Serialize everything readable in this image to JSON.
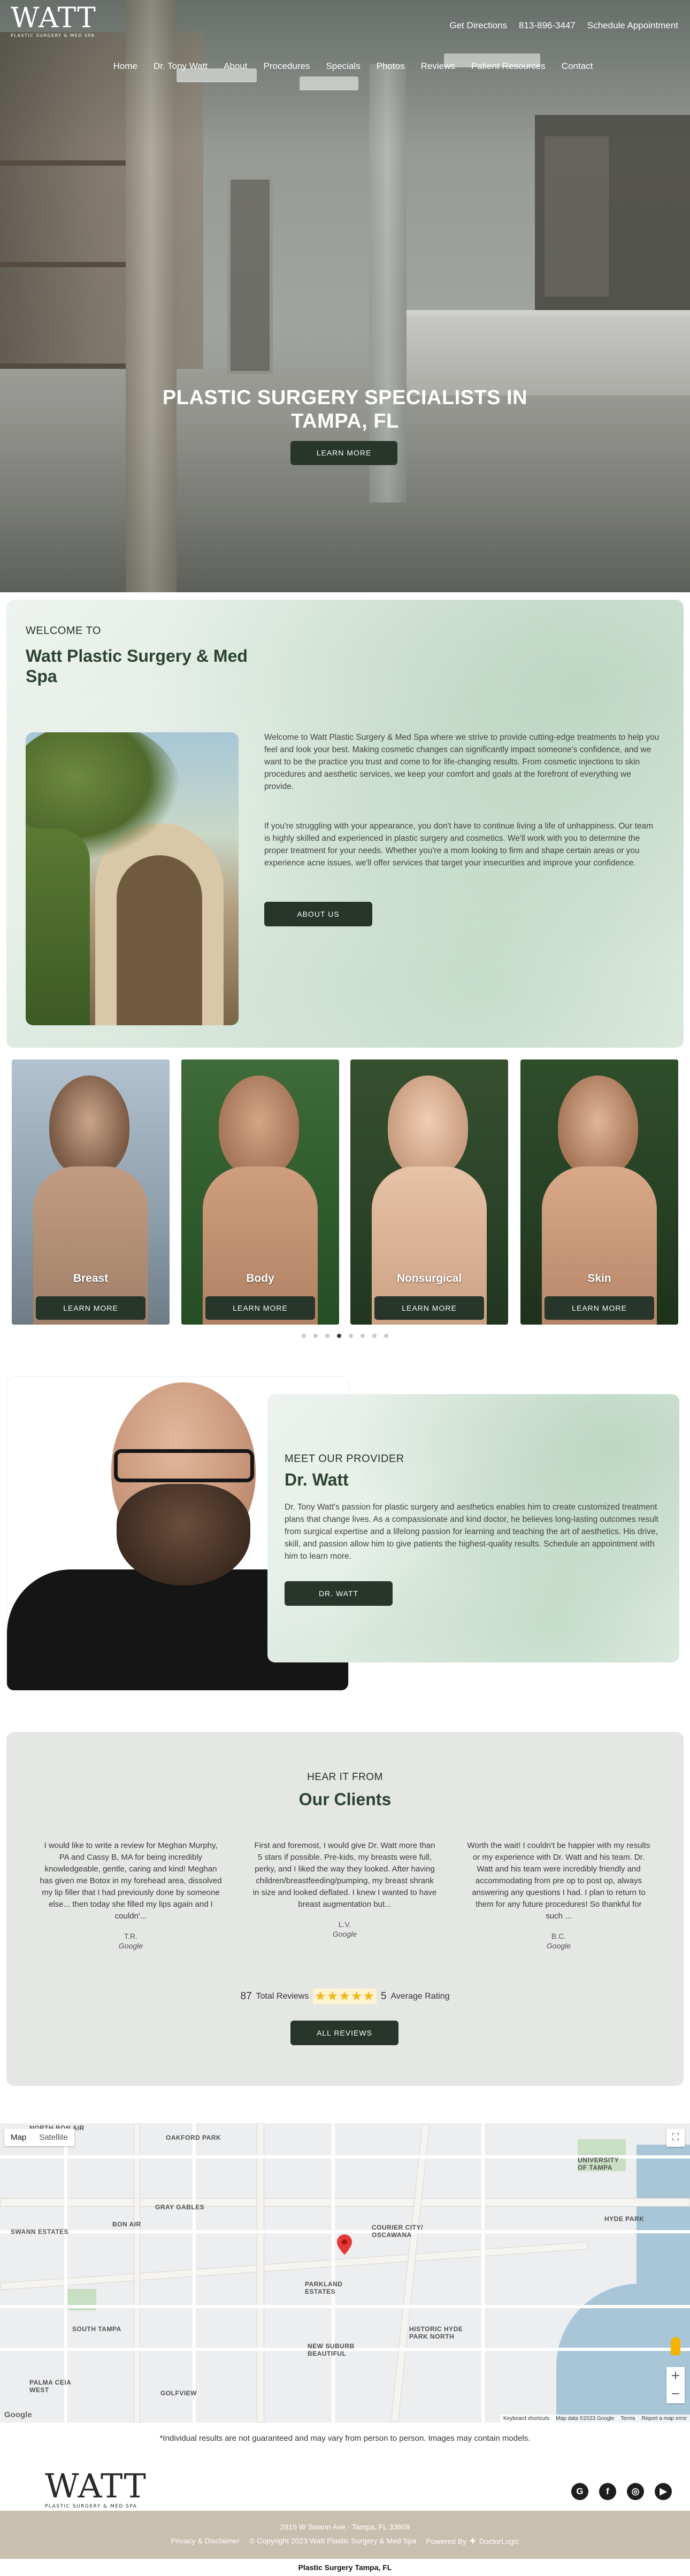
{
  "header": {
    "logo_text": "WATT",
    "logo_tagline": "PLASTIC SURGERY & MED SPA",
    "top_links": [
      "Get Directions",
      "813-896-3447",
      "Schedule Appointment"
    ],
    "nav": [
      "Home",
      "Dr. Tony Watt",
      "About",
      "Procedures",
      "Specials",
      "Photos",
      "Reviews",
      "Patient Resources",
      "Contact"
    ]
  },
  "hero": {
    "title_line1": "PLASTIC SURGERY SPECIALISTS IN",
    "title_line2": "TAMPA, FL",
    "button": "LEARN MORE"
  },
  "welcome": {
    "kicker": "WELCOME TO",
    "title": "Watt Plastic Surgery & Med Spa",
    "paragraph1": "Welcome to Watt Plastic Surgery & Med Spa where we strive to provide cutting-edge treatments to help you feel and look your best. Making cosmetic changes can significantly impact someone's confidence, and we want to be the practice you trust and come to for life-changing results. From cosmetic injections to skin procedures and aesthetic services, we keep your comfort and goals at the forefront of everything we provide.",
    "paragraph2": "If you're struggling with your appearance, you don't have to continue living a life of unhappiness. Our team is highly skilled and experienced in plastic surgery and cosmetics. We'll work with you to determine the proper treatment for your needs. Whether you're a mom looking to firm and shape certain areas or you experience acne issues, we'll offer services that target your insecurities and improve your confidence.",
    "button": "ABOUT US"
  },
  "procedures": {
    "cards": [
      {
        "label": "Breast",
        "button": "LEARN MORE"
      },
      {
        "label": "Body",
        "button": "LEARN MORE"
      },
      {
        "label": "Nonsurgical",
        "button": "LEARN MORE"
      },
      {
        "label": "Skin",
        "button": "LEARN MORE"
      }
    ],
    "dots_total": 8,
    "active_dot": 3
  },
  "provider": {
    "kicker": "MEET OUR PROVIDER",
    "name": "Dr. Watt",
    "bio": "Dr. Tony Watt's passion for plastic surgery and aesthetics enables him to create customized treatment plans that change lives. As a compassionate and kind doctor, he believes long-lasting outcomes result from surgical expertise and a lifelong passion for learning and teaching the art of aesthetics. His drive, skill, and passion allow him to give patients the highest-quality results. Schedule an appointment with him to learn more.",
    "button": "DR. WATT"
  },
  "reviews": {
    "kicker": "HEAR IT FROM",
    "title": "Our Clients",
    "items": [
      {
        "text": "I would like to write a review for Meghan Murphy, PA and Cassy B, MA for being incredibly knowledgeable, gentle, caring and kind! Meghan has given me Botox in my forehead area, dissolved my lip filler that I had previously done by someone else... then today she filled my lips again and I couldn'...",
        "name": "T.R.",
        "source": "Google"
      },
      {
        "text": "First and foremost, I would give Dr. Watt more than 5 stars if possible. Pre-kids, my breasts were full, perky, and I liked the way they looked. After having children/breastfeeding/pumping, my breast shrank in size and looked deflated. I knew I wanted to have breast augmentation but...",
        "name": "L.V.",
        "source": "Google"
      },
      {
        "text": "Worth the wait! I couldn't be happier with my results or my experience with Dr. Watt and his team. Dr. Watt and his team were incredibly friendly and accommodating from pre op to post op, always answering any questions I had. I plan to return to them for any future procedures! So thankful for such ...",
        "name": "B.C.",
        "source": "Google"
      }
    ],
    "total_count": "87",
    "total_label": "Total Reviews",
    "stars": "★★★★★",
    "rating_value": "5",
    "rating_label": "Average Rating",
    "button": "ALL REVIEWS"
  },
  "map": {
    "tab_map": "Map",
    "tab_satellite": "Satellite",
    "labels": [
      "NORTH BON AIR",
      "OAKFORD PARK",
      "UNIVERSITY OF TAMPA",
      "GRAY GABLES",
      "BON AIR",
      "SWANN ESTATES",
      "COURIER CITY/ OSCAWANA",
      "HYDE PARK",
      "PARKLAND ESTATES",
      "SOUTH TAMPA",
      "NEW SUBURB BEAUTIFUL",
      "HISTORIC HYDE PARK NORTH",
      "PALMA CEIA WEST",
      "GOLFVIEW"
    ],
    "footer": [
      "Keyboard shortcuts",
      "Map data ©2023 Google",
      "Terms",
      "Report a map error"
    ],
    "google": "Google"
  },
  "disclaimer": "*Individual results are not guaranteed and may vary from person to person. Images may contain models.",
  "footer": {
    "address": "2815 W Swann Ave · Tampa, FL 33609",
    "links": [
      "Privacy & Disclaimer",
      "© Copyright 2023 Watt Plastic Surgery & Med Spa"
    ],
    "powered_by": "Powered By",
    "powered_brand": "DoctorLogic",
    "bottom_title": "Plastic Surgery Tampa, FL"
  },
  "colors": {
    "accent": "#27352a",
    "heading_green": "#2b4330",
    "footer_band": "#c9bfae",
    "star": "#f2b51c"
  }
}
